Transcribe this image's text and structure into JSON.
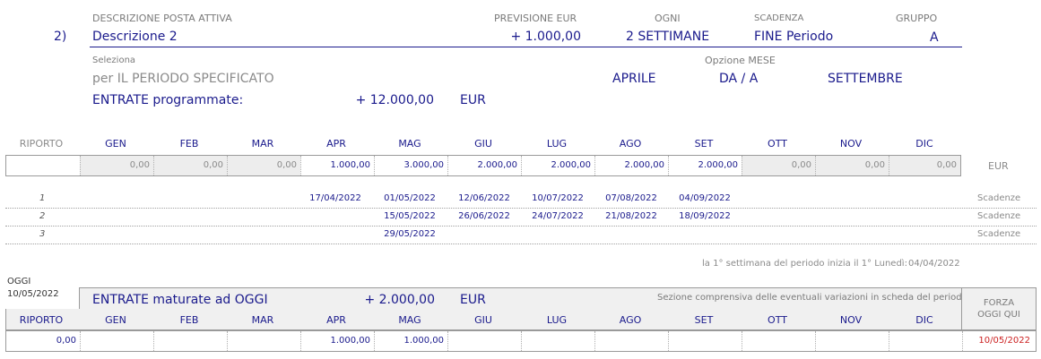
{
  "header": {
    "row_number": "2)",
    "descr_label": "DESCRIZIONE POSTA ATTIVA",
    "descr_value": "Descrizione 2",
    "prev_label": "PREVISIONE EUR",
    "prev_value": "+ 1.000,00",
    "ogni_label": "OGNI",
    "ogni_value": "2 SETTIMANE",
    "scad_label": "SCADENZA",
    "scad_value": "FINE Periodo",
    "gruppo_label": "GRUPPO",
    "gruppo_value": "A"
  },
  "selection": {
    "seleziona_label": "Seleziona",
    "periodo_value": "per IL PERIODO SPECIFICATO",
    "opzione_label": "Opzione MESE",
    "from_month": "APRILE",
    "da_a": "DA  / A",
    "to_month": "SETTEMBRE",
    "entrate_label": "ENTRATE programmate:",
    "entrate_value": "+ 12.000,00",
    "entrate_currency": "EUR"
  },
  "months_table": {
    "riporto_label": "RIPORTO",
    "months": [
      "GEN",
      "FEB",
      "MAR",
      "APR",
      "MAG",
      "GIU",
      "LUG",
      "AGO",
      "SET",
      "OTT",
      "NOV",
      "DIC"
    ],
    "values": [
      "0,00",
      "0,00",
      "0,00",
      "1.000,00",
      "3.000,00",
      "2.000,00",
      "2.000,00",
      "2.000,00",
      "2.000,00",
      "0,00",
      "0,00",
      "0,00"
    ],
    "currency": "EUR"
  },
  "schedule": {
    "rows": [
      {
        "num": "1",
        "dates": [
          "17/04/2022",
          "01/05/2022",
          "12/06/2022",
          "10/07/2022",
          "07/08/2022",
          "04/09/2022"
        ],
        "label": "Scadenze"
      },
      {
        "num": "2",
        "dates": [
          "",
          "15/05/2022",
          "26/06/2022",
          "24/07/2022",
          "21/08/2022",
          "18/09/2022"
        ],
        "label": "Scadenze"
      },
      {
        "num": "3",
        "dates": [
          "",
          "29/05/2022",
          "",
          "",
          "",
          ""
        ],
        "label": "Scadenze"
      }
    ],
    "note": "la 1° settimana del periodo inizia il 1° Lunedì:",
    "note_date": "04/04/2022"
  },
  "maturate": {
    "oggi_label": "OGGI",
    "oggi_date": "10/05/2022",
    "title": "ENTRATE maturate ad OGGI",
    "value": "+ 2.000,00",
    "currency": "EUR",
    "note": "Sezione comprensiva delle eventuali variazioni in scheda del periodo",
    "forza_line1": "FORZA",
    "forza_line2": "OGGI QUI",
    "riporto_label": "RIPORTO",
    "riporto_value": "0,00",
    "values": [
      "",
      "",
      "",
      "1.000,00",
      "1.000,00",
      "",
      "",
      "",
      "",
      "",
      "",
      ""
    ],
    "forza_date": "10/05/2022"
  }
}
